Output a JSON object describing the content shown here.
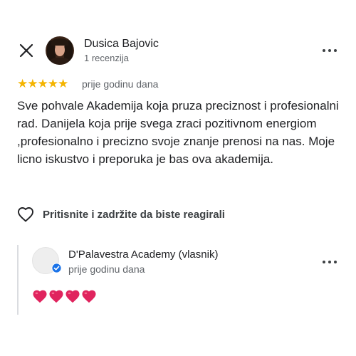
{
  "review": {
    "reviewer_name": "Dusica Bajovic",
    "reviewer_meta": "1 recenzija",
    "rating": 5,
    "stars_text": "★★★★★",
    "date": "prije godinu dana",
    "text": "Sve pohvale Akademija koja pruza preciznost i profesionalni rad. Danijela koja prije svega zraci pozitivnom energiom ,profesionalno i precizno svoje znanje prenosi na nas. Moje licno iskustvo i preporuka je bas ova akademija."
  },
  "reaction": {
    "label": "Pritisnite i zadržite da biste reagirali",
    "icon": "heart-outline-icon"
  },
  "owner_reply": {
    "name": "D'Palavestra Academy (vlasnik)",
    "date": "prije godinu dana",
    "content_emoji_count": 4,
    "content_icon": "red-heart-icon",
    "verified_icon": "verified-badge-icon"
  },
  "icons": {
    "close": "close-icon",
    "more": "more-options-icon"
  },
  "colors": {
    "star": "#f4b400",
    "verified": "#1a73e8",
    "heart": "#e0245e",
    "secondary_text": "#5f6368"
  }
}
